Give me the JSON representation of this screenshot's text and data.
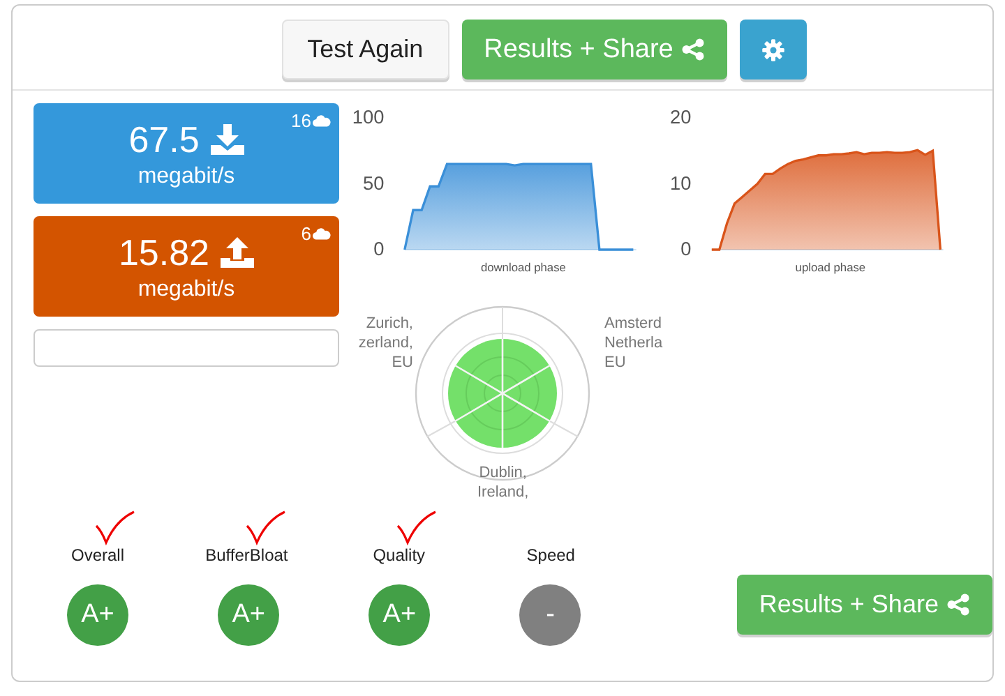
{
  "toolbar": {
    "buttons": [
      {
        "label": "Test Again",
        "kind": "plain"
      },
      {
        "label": "Results + Share",
        "kind": "share"
      },
      {
        "kind": "settings"
      }
    ]
  },
  "speeds": [
    {
      "kind": "download",
      "value": "67.5",
      "unit": "megabit/s",
      "streams": "16",
      "color": "#3498db"
    },
    {
      "kind": "upload",
      "value": "15.82",
      "unit": "megabit/s",
      "streams": "6",
      "color": "#d35400"
    }
  ],
  "charts": [
    {
      "chart_data": {
        "type": "area",
        "xlabel": "download phase",
        "ylim": [
          0,
          100
        ],
        "yticks": [
          0,
          50,
          100
        ],
        "series": [
          {
            "color": "#3a8fd8",
            "values": [
              0,
              30,
              30,
              48,
              48,
              65,
              65,
              65,
              65,
              65,
              65,
              65,
              65,
              64,
              65,
              65,
              65,
              65,
              65,
              65,
              65,
              65,
              65,
              0,
              0,
              0,
              0,
              0
            ]
          }
        ]
      }
    },
    {
      "chart_data": {
        "type": "area",
        "xlabel": "upload phase",
        "ylim": [
          0,
          20
        ],
        "yticks": [
          0,
          10,
          20
        ],
        "series": [
          {
            "color": "#d9541a",
            "values": [
              0,
              0,
              4,
              7,
              8,
              9,
              10,
              11.5,
              11.5,
              12.3,
              13,
              13.5,
              13.7,
              14,
              14.3,
              14.3,
              14.5,
              14.5,
              14.6,
              14.8,
              14.5,
              14.7,
              14.7,
              14.8,
              14.7,
              14.7,
              14.8,
              15.1,
              14.4,
              15,
              0
            ]
          }
        ]
      }
    }
  ],
  "servers": [
    {
      "lines": [
        "Zurich,",
        "zerland,",
        "EU"
      ]
    },
    {
      "lines": [
        "Amsterd",
        "Netherla",
        "EU"
      ]
    },
    {
      "lines": [
        "Dublin,",
        "Ireland,"
      ]
    }
  ],
  "grades": [
    {
      "label": "Overall",
      "grade": "A+",
      "color": "#43a047",
      "annotated": true
    },
    {
      "label": "BufferBloat",
      "grade": "A+",
      "color": "#43a047",
      "annotated": true
    },
    {
      "label": "Quality",
      "grade": "A+",
      "color": "#43a047",
      "annotated": true
    },
    {
      "label": "Speed",
      "grade": "-",
      "color": "#808080",
      "annotated": false
    }
  ],
  "share_button": {
    "label": "Results + Share"
  }
}
